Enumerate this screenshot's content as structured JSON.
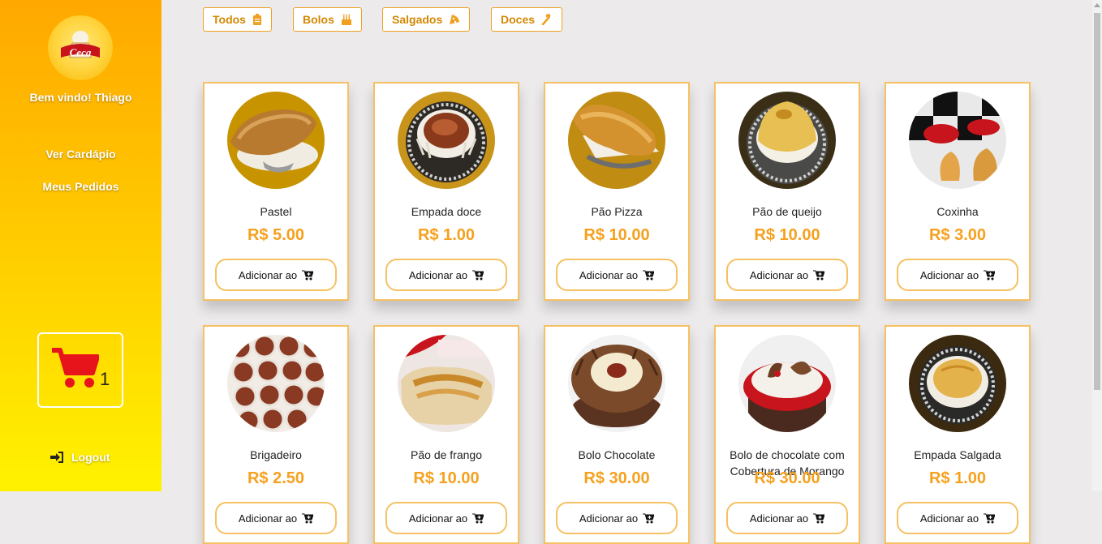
{
  "sidebar": {
    "welcome": "Bem vindo! Thiago",
    "nav": [
      {
        "label": "Ver Cardápio"
      },
      {
        "label": "Meus Pedidos"
      }
    ],
    "cart_count": "1",
    "logout_label": "Logout"
  },
  "logo": {
    "text": "Ceca"
  },
  "filters": [
    {
      "label": "Todos",
      "icon": "clipboard-icon"
    },
    {
      "label": "Bolos",
      "icon": "birthday-cake-icon"
    },
    {
      "label": "Salgados",
      "icon": "pizza-slice-icon"
    },
    {
      "label": "Doces",
      "icon": "candy-cane-icon"
    }
  ],
  "products": [
    {
      "name": "Pastel",
      "price": "R$ 5.00",
      "button": "Adicionar ao"
    },
    {
      "name": "Empada doce",
      "price": "R$ 1.00",
      "button": "Adicionar ao"
    },
    {
      "name": "Pão Pizza",
      "price": "R$ 10.00",
      "button": "Adicionar ao"
    },
    {
      "name": "Pão de queijo",
      "price": "R$ 10.00",
      "button": "Adicionar ao"
    },
    {
      "name": "Coxinha",
      "price": "R$ 3.00",
      "button": "Adicionar ao"
    },
    {
      "name": "Brigadeiro",
      "price": "R$ 2.50",
      "button": "Adicionar ao"
    },
    {
      "name": "Pão de frango",
      "price": "R$ 10.00",
      "button": "Adicionar ao"
    },
    {
      "name": "Bolo Chocolate",
      "price": "R$ 30.00",
      "button": "Adicionar ao"
    },
    {
      "name": "Bolo de chocolate com Cobertura de Morango",
      "price": "R$ 30.00",
      "button": "Adicionar ao"
    },
    {
      "name": "Empada Salgada",
      "price": "R$ 1.00",
      "button": "Adicionar ao"
    }
  ],
  "colors": {
    "accent": "#f5a11f",
    "border": "#f5c163",
    "cart": "#e8141c"
  }
}
